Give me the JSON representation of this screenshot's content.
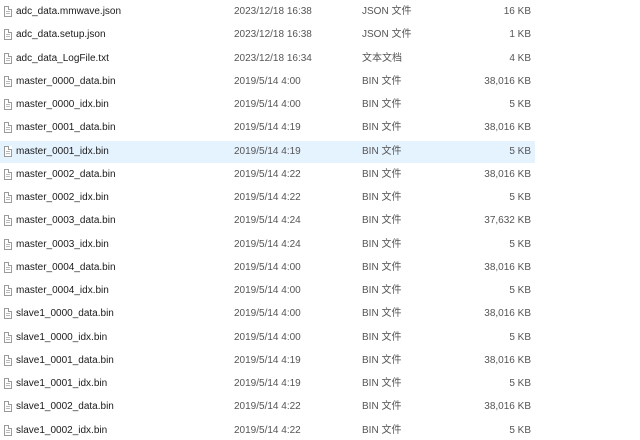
{
  "files": [
    {
      "name": "adc_data.mmwave.json",
      "date": "2023/12/18 16:38",
      "type": "JSON 文件",
      "size": "16 KB",
      "icon": "file-icon"
    },
    {
      "name": "adc_data.setup.json",
      "date": "2023/12/18 16:38",
      "type": "JSON 文件",
      "size": "1 KB",
      "icon": "file-icon"
    },
    {
      "name": "adc_data_LogFile.txt",
      "date": "2023/12/18 16:34",
      "type": "文本文档",
      "size": "4 KB",
      "icon": "file-icon"
    },
    {
      "name": "master_0000_data.bin",
      "date": "2019/5/14 4:00",
      "type": "BIN 文件",
      "size": "38,016 KB",
      "icon": "file-icon"
    },
    {
      "name": "master_0000_idx.bin",
      "date": "2019/5/14 4:00",
      "type": "BIN 文件",
      "size": "5 KB",
      "icon": "file-icon"
    },
    {
      "name": "master_0001_data.bin",
      "date": "2019/5/14 4:19",
      "type": "BIN 文件",
      "size": "38,016 KB",
      "icon": "file-icon"
    },
    {
      "name": "master_0001_idx.bin",
      "date": "2019/5/14 4:19",
      "type": "BIN 文件",
      "size": "5 KB",
      "icon": "file-icon",
      "selected": true
    },
    {
      "name": "master_0002_data.bin",
      "date": "2019/5/14 4:22",
      "type": "BIN 文件",
      "size": "38,016 KB",
      "icon": "file-icon"
    },
    {
      "name": "master_0002_idx.bin",
      "date": "2019/5/14 4:22",
      "type": "BIN 文件",
      "size": "5 KB",
      "icon": "file-icon"
    },
    {
      "name": "master_0003_data.bin",
      "date": "2019/5/14 4:24",
      "type": "BIN 文件",
      "size": "37,632 KB",
      "icon": "file-icon"
    },
    {
      "name": "master_0003_idx.bin",
      "date": "2019/5/14 4:24",
      "type": "BIN 文件",
      "size": "5 KB",
      "icon": "file-icon"
    },
    {
      "name": "master_0004_data.bin",
      "date": "2019/5/14 4:00",
      "type": "BIN 文件",
      "size": "38,016 KB",
      "icon": "file-icon"
    },
    {
      "name": "master_0004_idx.bin",
      "date": "2019/5/14 4:00",
      "type": "BIN 文件",
      "size": "5 KB",
      "icon": "file-icon"
    },
    {
      "name": "slave1_0000_data.bin",
      "date": "2019/5/14 4:00",
      "type": "BIN 文件",
      "size": "38,016 KB",
      "icon": "file-icon"
    },
    {
      "name": "slave1_0000_idx.bin",
      "date": "2019/5/14 4:00",
      "type": "BIN 文件",
      "size": "5 KB",
      "icon": "file-icon"
    },
    {
      "name": "slave1_0001_data.bin",
      "date": "2019/5/14 4:19",
      "type": "BIN 文件",
      "size": "38,016 KB",
      "icon": "file-icon"
    },
    {
      "name": "slave1_0001_idx.bin",
      "date": "2019/5/14 4:19",
      "type": "BIN 文件",
      "size": "5 KB",
      "icon": "file-icon"
    },
    {
      "name": "slave1_0002_data.bin",
      "date": "2019/5/14 4:22",
      "type": "BIN 文件",
      "size": "38,016 KB",
      "icon": "file-icon"
    },
    {
      "name": "slave1_0002_idx.bin",
      "date": "2019/5/14 4:22",
      "type": "BIN 文件",
      "size": "5 KB",
      "icon": "file-icon"
    }
  ],
  "colors": {
    "selected_row_background": "#e5f3ff",
    "name_text": "#1a1a1a",
    "detail_text": "#555555"
  }
}
